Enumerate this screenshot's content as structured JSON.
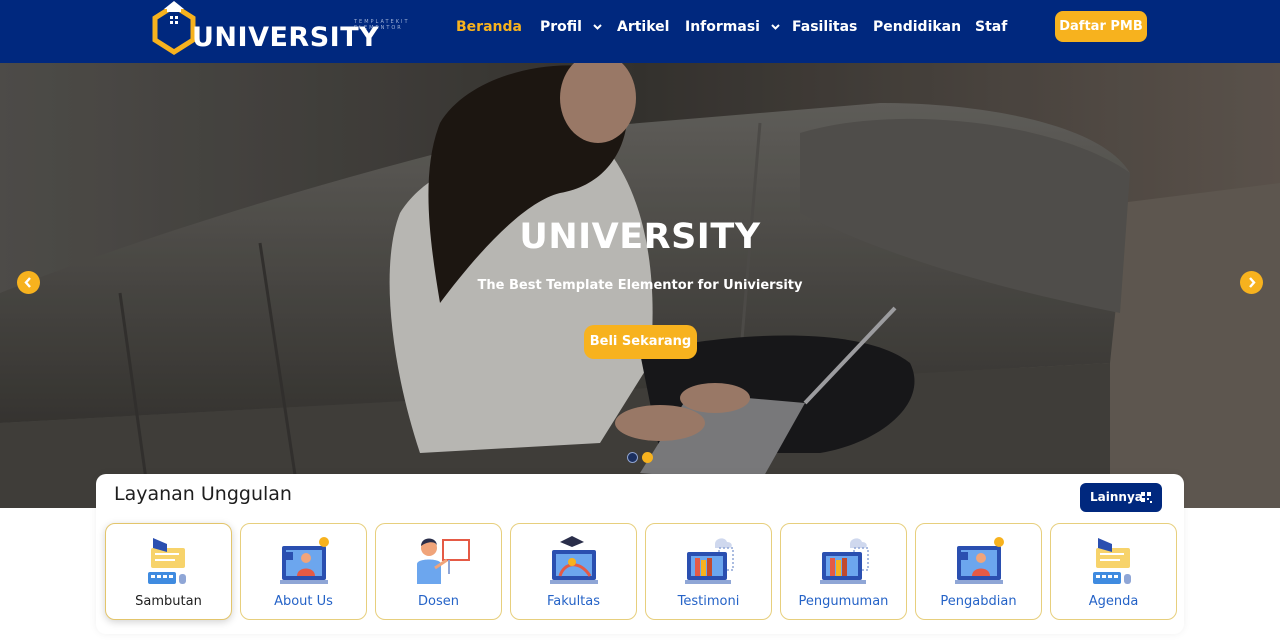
{
  "colors": {
    "navy": "#00287e",
    "accent": "#f7b21e",
    "link": "#2563c7"
  },
  "brand": {
    "small_text": "TEMPLATEKIT ELEMENTOR",
    "name": "UNIVERSITY"
  },
  "nav": {
    "items": [
      {
        "label": "Beranda",
        "active": true,
        "dropdown": false
      },
      {
        "label": "Profil",
        "active": false,
        "dropdown": true
      },
      {
        "label": "Artikel",
        "active": false,
        "dropdown": false
      },
      {
        "label": "Informasi",
        "active": false,
        "dropdown": true
      },
      {
        "label": "Fasilitas",
        "active": false,
        "dropdown": false
      },
      {
        "label": "Pendidikan",
        "active": false,
        "dropdown": false
      },
      {
        "label": "Staf",
        "active": false,
        "dropdown": false
      }
    ],
    "cta_label": "Daftar PMB"
  },
  "hero": {
    "title": "UNIVERSITY",
    "subtitle": "The Best Template Elementor for Univiersity",
    "button_label": "Beli Sekarang",
    "prev_icon": "chevron-left-icon",
    "next_icon": "chevron-right-icon",
    "slide_count": 2,
    "active_slide": 2
  },
  "services": {
    "title": "Layanan Unggulan",
    "more_label": "Lainnya",
    "cards": [
      {
        "label": "Sambutan",
        "icon": "keyboard-megaphone-icon",
        "active": true
      },
      {
        "label": "About Us",
        "icon": "video-teacher-icon",
        "active": false
      },
      {
        "label": "Dosen",
        "icon": "lecturer-board-icon",
        "active": false
      },
      {
        "label": "Fakultas",
        "icon": "graduation-monitor-icon",
        "active": false
      },
      {
        "label": "Testimoni",
        "icon": "books-cloud-icon",
        "active": false
      },
      {
        "label": "Pengumuman",
        "icon": "books-cloud-icon",
        "active": false
      },
      {
        "label": "Pengabdian",
        "icon": "video-teacher-icon",
        "active": false
      },
      {
        "label": "Agenda",
        "icon": "keyboard-megaphone-icon",
        "active": false
      }
    ]
  }
}
